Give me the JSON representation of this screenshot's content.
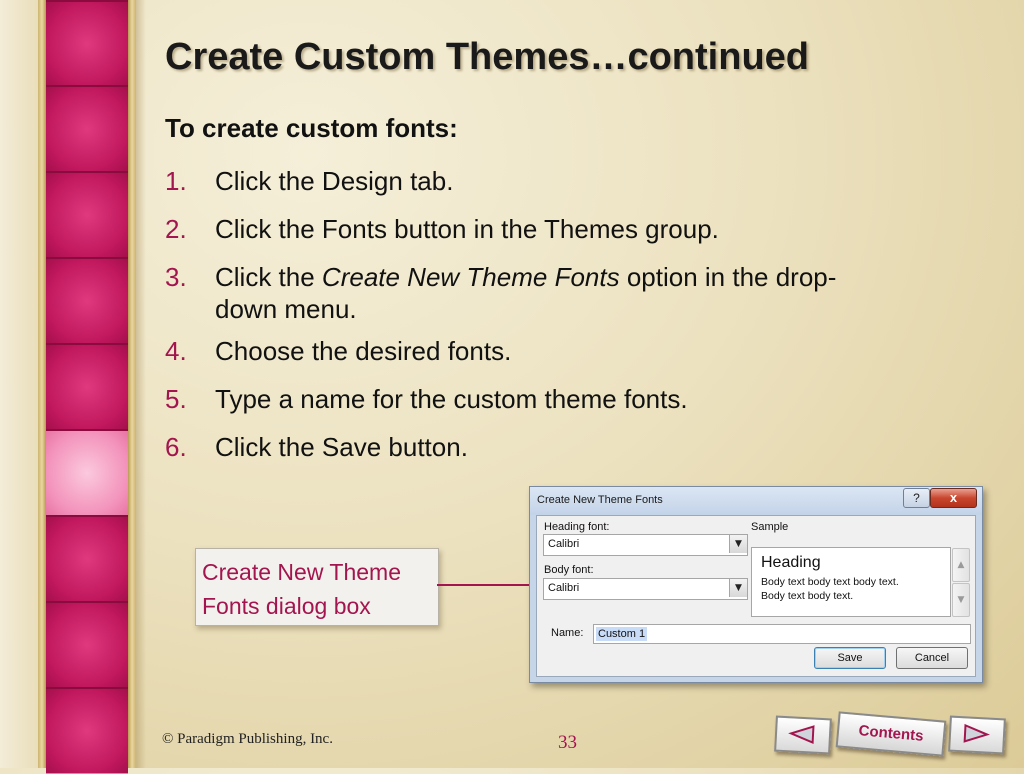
{
  "slide": {
    "title": "Create Custom Themes…continued",
    "subtitle": "To create custom fonts:",
    "steps": [
      {
        "num": "1.",
        "text": "Click the Design tab."
      },
      {
        "num": "2.",
        "text": "Click the Fonts button in the Themes group."
      },
      {
        "num": "3.",
        "pre": "Click the ",
        "em": "Create New Theme Fonts",
        "post": " option in the drop-",
        "cont": "down menu."
      },
      {
        "num": "4.",
        "text": "Choose the desired fonts."
      },
      {
        "num": "5.",
        "text": "Type a name for the custom theme fonts."
      },
      {
        "num": "6.",
        "text": "Click the Save button."
      }
    ]
  },
  "callout": {
    "text": "Create New Theme Fonts dialog box"
  },
  "dialog": {
    "title": "Create New Theme Fonts",
    "help_label": "?",
    "close_label": "x",
    "heading_font_label": "Heading font:",
    "heading_font_value": "Calibri",
    "body_font_label": "Body font:",
    "body_font_value": "Calibri",
    "sample_label": "Sample",
    "sample_heading": "Heading",
    "sample_body_line1": "Body text body text body text.",
    "sample_body_line2": "Body text body text.",
    "name_label": "Name:",
    "name_value": "Custom 1",
    "save_label": "Save",
    "cancel_label": "Cancel"
  },
  "footer": {
    "copyright": "© Paradigm Publishing, Inc.",
    "page_number": "33",
    "contents_label": "Contents"
  },
  "colors": {
    "accent": "#a3154e",
    "pink_strip": "#c0175d",
    "background": "#ece2c0"
  },
  "icons": {
    "prev": "triangle-left-icon",
    "next": "triangle-right-icon"
  }
}
